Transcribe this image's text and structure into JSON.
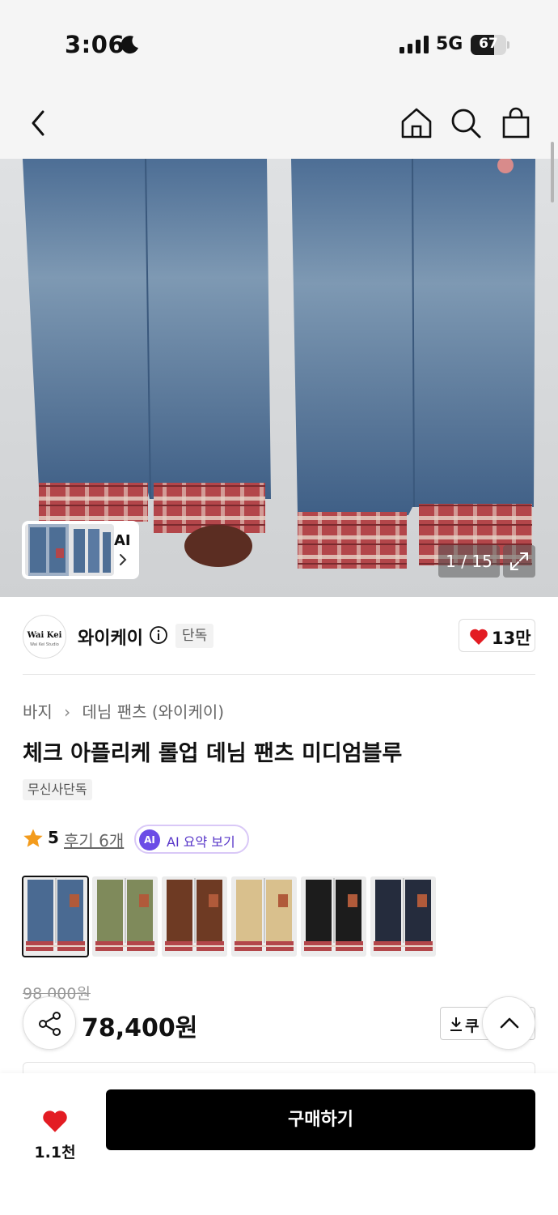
{
  "status_bar": {
    "time": "3:06",
    "network": "5G",
    "battery": "67",
    "battery_level": 0.67
  },
  "nav": {
    "back_icon": "chevron-left-icon",
    "home_icon": "home-icon",
    "search_icon": "search-icon",
    "cart_icon": "shopping-bag-icon"
  },
  "gallery": {
    "ai_label": "AI",
    "counter": "1 / 15",
    "expand_icon": "expand-icon"
  },
  "brand": {
    "logo_text": "Wai Kei",
    "logo_subtext": "Wai Kei Studio",
    "name": "와이케이",
    "exclusive_badge": "단독",
    "like_count": "13만",
    "heart_color": "#e31c23"
  },
  "product": {
    "breadcrumb": [
      "바지",
      "데님 팬츠 (와이케이)"
    ],
    "title": "체크 아플리케 롤업 데님 팬츠 미디엄블루",
    "tag": "무신사단독",
    "rating": "5",
    "review_link": "후기 6개",
    "ai_summary_badge": "AI",
    "ai_summary_label": "AI 요약 보기",
    "ai_color": "#6b4ce6"
  },
  "colors": [
    {
      "name": "미디엄블루",
      "hex": "#4a6a92",
      "selected": true
    },
    {
      "name": "카키",
      "hex": "#7f8a5b",
      "selected": false
    },
    {
      "name": "브라운",
      "hex": "#6e3a23",
      "selected": false
    },
    {
      "name": "베이지",
      "hex": "#d9c08d",
      "selected": false
    },
    {
      "name": "블랙",
      "hex": "#1c1c1c",
      "selected": false
    },
    {
      "name": "다크블루",
      "hex": "#252c3d",
      "selected": false
    }
  ],
  "price": {
    "original": "98,000원",
    "sale": "78,400원",
    "coupon_label": "쿠"
  },
  "bottom_bar": {
    "wish_count": "1.1천",
    "buy_label": "구매하기"
  }
}
